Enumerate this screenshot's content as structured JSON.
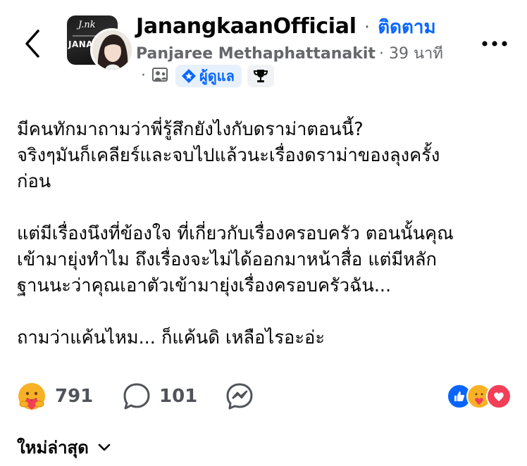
{
  "header": {
    "group_name": "JanangkaanOfficial",
    "separator": "·",
    "follow_label": "ติดตาม",
    "author_name": "Panjaree Methaphattanakit",
    "time": "· 39 นาที",
    "meta_dot": "·",
    "admin_label": "ผู้ดูแล",
    "group_avatar_text": {
      "logo": "J.nk",
      "name": "JANAN"
    },
    "icons": [
      "back-arrow-icon",
      "group-privacy-icon",
      "admin-shield-icon",
      "top-contributor-trophy-icon",
      "more-icon"
    ]
  },
  "post": {
    "paragraphs": [
      "มีคนทักมาถามว่าพี่รู้สึกยังไงกับดราม่าตอนนี้?\nจริงๆมันก็เคลียร์และจบไปแล้วนะเรื่องดราม่าของลุงครั้ง\nก่อน",
      "แต่มีเรื่องนึงที่ข้องใจ ที่เกี่ยวกับเรื่องครอบครัว ตอนนั้นคุณ\nเข้ามายุ่งทำไม ถึงเรื่องจะไม่ได้ออกมาหน้าสื่อ แต่มีหลัก\nฐานนะว่าคุณเอาตัวเข้ามายุ่งเรื่องครอบครัวฉัน...",
      "ถามว่าแค้นไหม... ก็แค้นดิ เหลือไรอะอ่ะ"
    ]
  },
  "actions": {
    "reaction_count": "791",
    "comment_count": "101",
    "reaction_icons": [
      "like-icon",
      "care-icon",
      "love-icon"
    ]
  },
  "comments": {
    "sort_label": "ใหม่ล่าสุด"
  },
  "colors": {
    "accent": "#0866ff",
    "secondary_text": "#65676b",
    "love": "#f33e58",
    "care": "#f7b125"
  }
}
